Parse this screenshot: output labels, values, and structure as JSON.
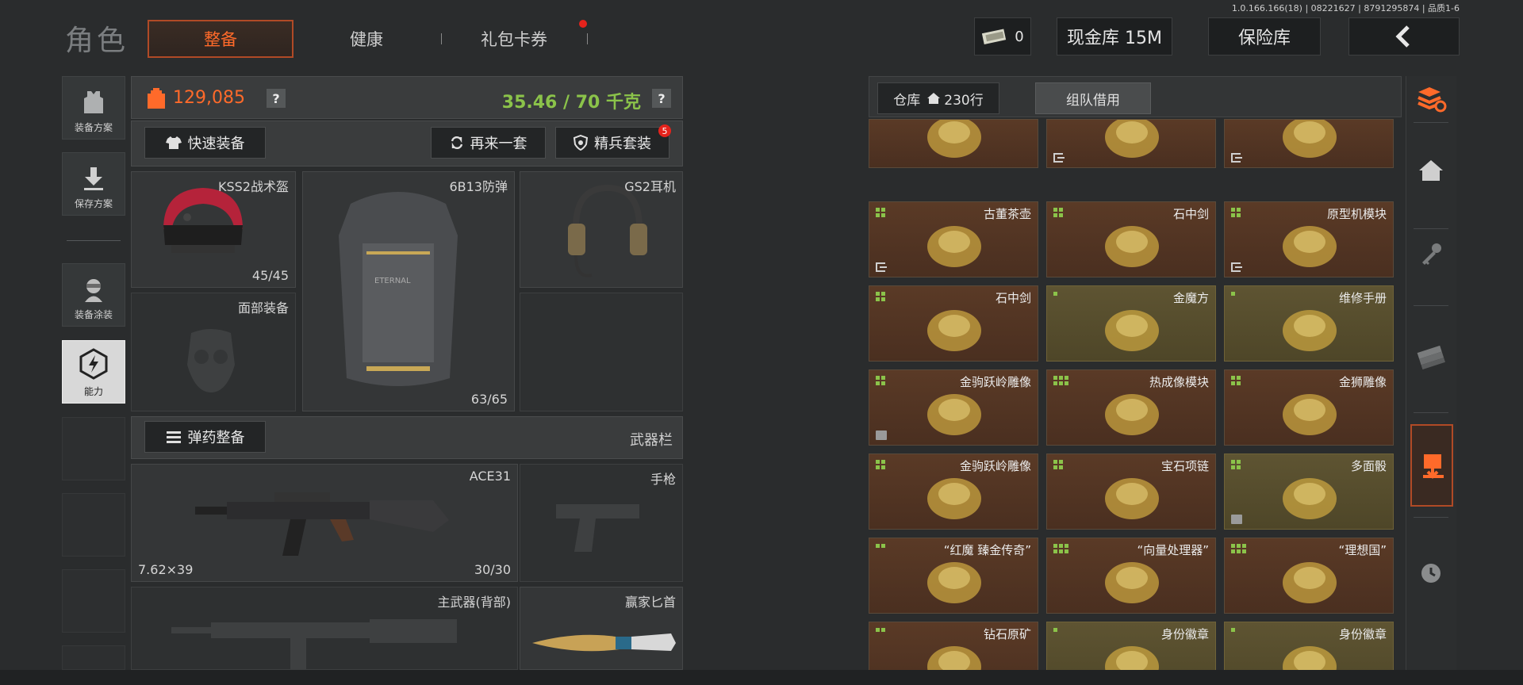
{
  "version": "1.0.166.166(18) | 08221627 | 8791295874 | 品质1-6",
  "header": {
    "title": "角色",
    "tabs": [
      {
        "label": "整备",
        "active": true
      },
      {
        "label": "健康",
        "active": false
      },
      {
        "label": "礼包卡券",
        "active": false,
        "badge": true
      }
    ],
    "currency_value": "0",
    "cash_warehouse": "现金库 15M",
    "insurance": "保险库"
  },
  "left_nav": [
    {
      "label": "装备方案",
      "icon": "vest-icon"
    },
    {
      "label": "保存方案",
      "icon": "download-icon"
    },
    {
      "label": "装备涂装",
      "icon": "soldier-icon"
    },
    {
      "label": "能力",
      "icon": "ability-icon",
      "active": true
    }
  ],
  "loadout": {
    "value": "129,085",
    "weight": "35.46 / 70 千克",
    "help": "?",
    "quick_equip": "快速装备",
    "again": "再来一套",
    "elite": "精兵套装",
    "elite_badge": "5",
    "helmet": {
      "name": "KSS2战术盔",
      "count": "45/45"
    },
    "armor": {
      "name": "6B13防弹",
      "count": "63/65"
    },
    "headset": {
      "name": "GS2耳机"
    },
    "face": {
      "name": "面部装备"
    },
    "ammo_equip": "弹药整备",
    "weapon_bar": "武器栏",
    "primary": {
      "name": "ACE31",
      "caliber": "7.62×39",
      "count": "30/30"
    },
    "pistol": {
      "name": "手枪"
    },
    "secondary": {
      "name": "主武器(背部)"
    },
    "knife": {
      "name": "赢家匕首"
    }
  },
  "warehouse": {
    "tab_label": "仓库",
    "rows_label": "230行",
    "team_borrow": "组队借用",
    "items": [
      {
        "name": "",
        "color": "brown",
        "exit": false
      },
      {
        "name": "",
        "color": "brown",
        "exit": true
      },
      {
        "name": "",
        "color": "brown",
        "exit": true
      },
      {
        "name": "古董茶壶",
        "color": "brown",
        "grid": 4,
        "exit": true
      },
      {
        "name": "石中剑",
        "color": "brown",
        "grid": 4,
        "exit": false
      },
      {
        "name": "原型机模块",
        "color": "brown",
        "grid": 4,
        "exit": true
      },
      {
        "name": "石中剑",
        "color": "brown",
        "grid": 4,
        "exit": false
      },
      {
        "name": "金魔方",
        "color": "olive",
        "grid": 1,
        "exit": false
      },
      {
        "name": "维修手册",
        "color": "olive",
        "grid": 1,
        "exit": false
      },
      {
        "name": "金驹跃岭雕像",
        "color": "brown",
        "grid": 4,
        "pkg": true
      },
      {
        "name": "热成像模块",
        "color": "brown",
        "grid": 6,
        "exit": false
      },
      {
        "name": "金狮雕像",
        "color": "brown",
        "grid": 4,
        "exit": false
      },
      {
        "name": "金驹跃岭雕像",
        "color": "brown",
        "grid": 4,
        "exit": false
      },
      {
        "name": "宝石项链",
        "color": "brown",
        "grid": 4,
        "exit": false
      },
      {
        "name": "多面骰",
        "color": "olive",
        "grid": 4,
        "pkg": true
      },
      {
        "name": "“红魔 臻金传奇”",
        "color": "brown",
        "grid": 2,
        "exit": false
      },
      {
        "name": "“向量处理器”",
        "color": "brown",
        "grid": 6,
        "exit": false
      },
      {
        "name": "“理想国”",
        "color": "brown",
        "grid": 6,
        "exit": false
      },
      {
        "name": "钻石原矿",
        "color": "brown",
        "grid": 2,
        "exit": false
      },
      {
        "name": "身份徽章",
        "color": "olive",
        "grid": 1,
        "exit": true
      },
      {
        "name": "身份徽章",
        "color": "olive",
        "grid": 1,
        "exit": true
      }
    ]
  },
  "colors": {
    "accent": "#ff6a2a",
    "weight_green": "#8bc34a",
    "badge_red": "#e5231c"
  }
}
